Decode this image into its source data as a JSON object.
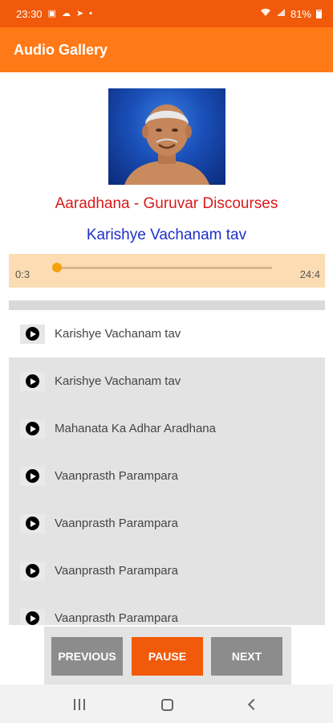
{
  "status_bar": {
    "time": "23:30",
    "battery": "81%",
    "icons": [
      "image-icon",
      "cloud-icon",
      "telegram-icon",
      "dot-icon",
      "wifi-icon",
      "signal-icon",
      "battery-icon"
    ]
  },
  "app_bar": {
    "title": "Audio Gallery"
  },
  "album": {
    "title": "Aaradhana - Guruvar Discourses"
  },
  "now_playing": {
    "title": "Karishye Vachanam tav"
  },
  "player": {
    "current_time": "0:3",
    "total_time": "24:4",
    "progress": 0.02
  },
  "tracks": [
    {
      "title": "Karishye Vachanam tav"
    },
    {
      "title": "Karishye Vachanam tav"
    },
    {
      "title": "Mahanata Ka Adhar Aradhana"
    },
    {
      "title": "Vaanprasth Parampara"
    },
    {
      "title": "Vaanprasth Parampara"
    },
    {
      "title": "Vaanprasth Parampara"
    },
    {
      "title": "Vaanprasth Parampara"
    }
  ],
  "controls": {
    "previous": "PREVIOUS",
    "pause": "PAUSE",
    "next": "NEXT"
  },
  "colors": {
    "status_bar": "#f15a0a",
    "app_bar": "#ff7a17",
    "album_title": "#d71a1a",
    "track_title": "#1f2fc8",
    "player_bg": "#fcdcb2",
    "seek_thumb": "#f4a20b"
  }
}
